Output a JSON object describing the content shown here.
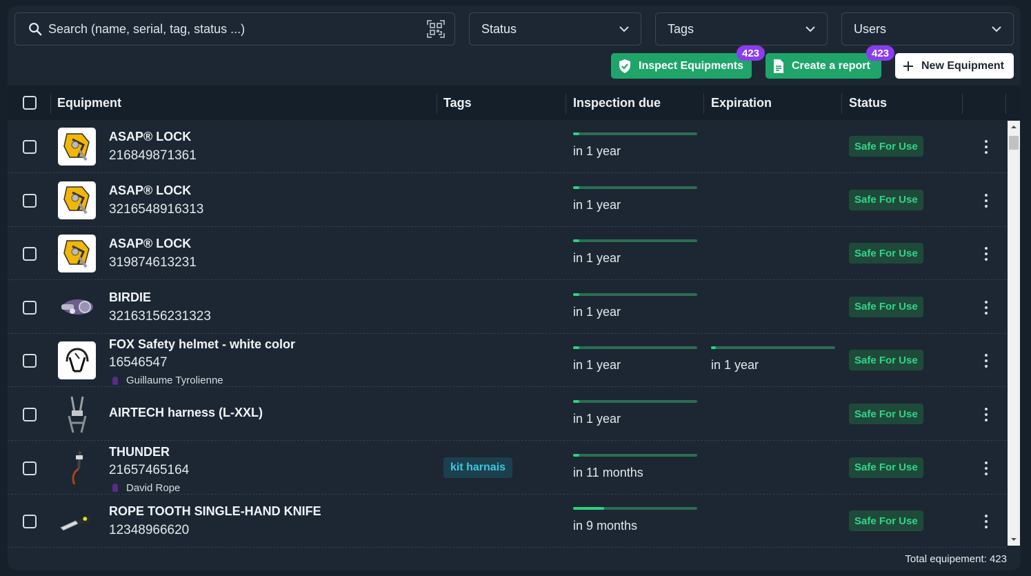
{
  "search": {
    "placeholder": "Search (name, serial, tag, status ...)"
  },
  "filters": {
    "status": "Status",
    "tags": "Tags",
    "users": "Users"
  },
  "actions": {
    "inspect": {
      "label": "Inspect Equipments",
      "badge": "423"
    },
    "report": {
      "label": "Create a report",
      "badge": "423"
    },
    "new": {
      "label": "New Equipment"
    }
  },
  "columns": {
    "equipment": "Equipment",
    "tags": "Tags",
    "inspection_due": "Inspection due",
    "expiration": "Expiration",
    "status": "Status"
  },
  "rows": [
    {
      "name": "ASAP® LOCK",
      "serial": "216849871361",
      "owner": "",
      "tag": "",
      "inspection": "in 1 year",
      "inspection_progress": 0.05,
      "expiration": "",
      "expiration_progress": null,
      "status": "Safe For Use",
      "thumb": "asap"
    },
    {
      "name": "ASAP® LOCK",
      "serial": "3216548916313",
      "owner": "",
      "tag": "",
      "inspection": "in 1 year",
      "inspection_progress": 0.05,
      "expiration": "",
      "expiration_progress": null,
      "status": "Safe For Use",
      "thumb": "asap"
    },
    {
      "name": "ASAP® LOCK",
      "serial": "319874613231",
      "owner": "",
      "tag": "",
      "inspection": "in 1 year",
      "inspection_progress": 0.05,
      "expiration": "",
      "expiration_progress": null,
      "status": "Safe For Use",
      "thumb": "asap"
    },
    {
      "name": "BIRDIE",
      "serial": "32163156231323",
      "owner": "",
      "tag": "",
      "inspection": "in 1 year",
      "inspection_progress": 0.05,
      "expiration": "",
      "expiration_progress": null,
      "status": "Safe For Use",
      "thumb": "birdie"
    },
    {
      "name": "FOX Safety helmet - white color",
      "serial": "16546547",
      "owner": "Guillaume Tyrolienne",
      "tag": "",
      "inspection": "in 1 year",
      "inspection_progress": 0.05,
      "expiration": "in 1 year",
      "expiration_progress": 0.04,
      "status": "Safe For Use",
      "thumb": "helmet"
    },
    {
      "name": "AIRTECH harness (L-XXL)",
      "serial": "",
      "owner": "",
      "tag": "",
      "inspection": "in 1 year",
      "inspection_progress": 0.05,
      "expiration": "",
      "expiration_progress": null,
      "status": "Safe For Use",
      "thumb": "harness"
    },
    {
      "name": "THUNDER",
      "serial": "21657465164",
      "owner": "David Rope",
      "tag": "kit harnais",
      "inspection": "in 11 months",
      "inspection_progress": 0.05,
      "expiration": "",
      "expiration_progress": null,
      "status": "Safe For Use",
      "thumb": "thunder"
    },
    {
      "name": "ROPE TOOTH SINGLE-HAND KNIFE",
      "serial": "12348966620",
      "owner": "",
      "tag": "",
      "inspection": "in 9 months",
      "inspection_progress": 0.25,
      "expiration": "",
      "expiration_progress": null,
      "status": "Safe For Use",
      "thumb": "knife"
    }
  ],
  "footer": {
    "total": "Total equipement: 423"
  }
}
